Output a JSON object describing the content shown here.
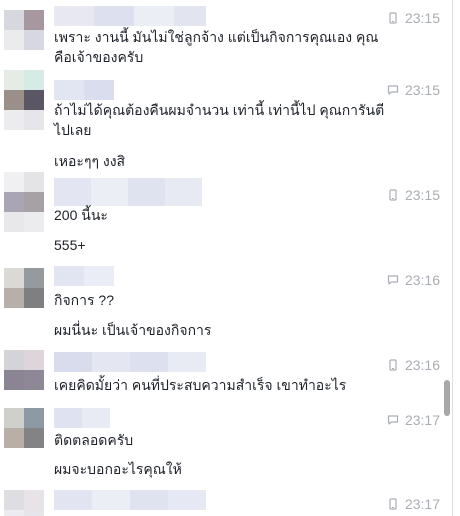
{
  "messages": [
    {
      "time": "23:15",
      "icon": "mobile-icon",
      "lines": [
        "เพราะ งานนี้ มันไม่ใช่ลูกจ้าง แต่เป็นกิจการคุณเอง คุณ",
        "คือเจ้าของครับ"
      ]
    },
    {
      "time": "23:15",
      "icon": "speech-bubble-icon",
      "lines": [
        "ถ้าไม่ได้คุณต้องคืนผมจำนวน เท่านี้ เท่านี้ไป คุณการันตี",
        "ไปเลย"
      ],
      "extra": "เหอะๆๆ งงสิ"
    },
    {
      "time": "23:15",
      "icon": "mobile-icon",
      "lines": [
        "200 นี้นะ"
      ],
      "extra": "555+"
    },
    {
      "time": "23:16",
      "icon": "speech-bubble-icon",
      "lines": [
        "กิจการ ??"
      ],
      "extra": "ผมนี่นะ เป็นเจ้าของกิจการ"
    },
    {
      "time": "23:16",
      "icon": "mobile-icon",
      "lines": [
        "เคยคิดมั้ยว่า คนที่ประสบความสำเร็จ เขาทำอะไร"
      ]
    },
    {
      "time": "23:17",
      "icon": "speech-bubble-icon",
      "lines": [
        "ติดตลอดครับ"
      ],
      "extra": "ผมจะบอกอะไรคุณให้"
    },
    {
      "time": "23:17",
      "icon": "mobile-icon",
      "lines": []
    }
  ]
}
